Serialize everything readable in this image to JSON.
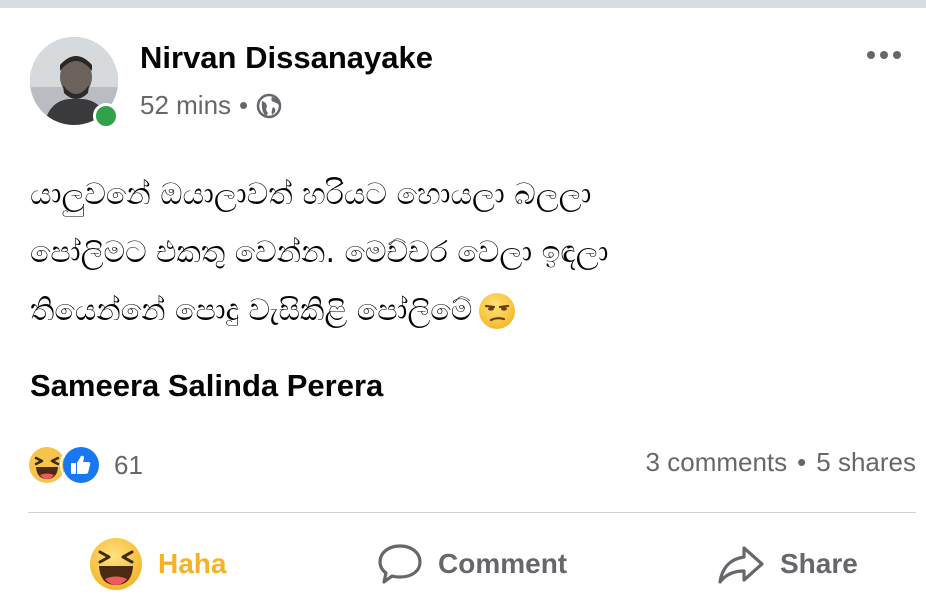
{
  "post": {
    "author": "Nirvan Dissanayake",
    "time": "52 mins",
    "separator": "•",
    "privacy_icon": "globe-icon",
    "lines": [
      "යාලුවනේ ඔයාලාවත් හරියට හොයලා බලලා",
      "පෝලිමට එකතු වෙන්න. මෙච්චර වෙලා ඉඳලා",
      "තියෙන්නේ පොදු වැසිකිළි පෝලිමේ"
    ],
    "emoji": "unamused-face",
    "tagged_name": "Sameera Salinda Perera"
  },
  "reactions": {
    "icons": [
      "haha-icon",
      "like-icon"
    ],
    "count": "61"
  },
  "stats": {
    "comments": "3 comments",
    "dot": "•",
    "shares": "5 shares"
  },
  "actions": {
    "haha": "Haha",
    "comment": "Comment",
    "share": "Share"
  },
  "colors": {
    "haha_accent": "#f7b125",
    "like_blue": "#1877f2",
    "muted": "#65676b",
    "online": "#31a24c"
  }
}
